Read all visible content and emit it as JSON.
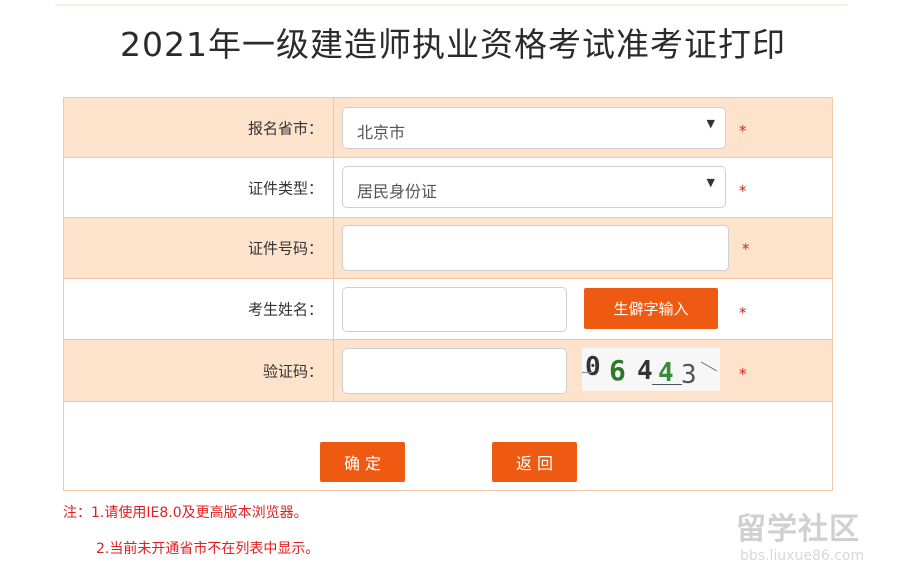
{
  "page": {
    "title": "2021年一级建造师执业资格考试准考证打印"
  },
  "form": {
    "province": {
      "label": "报名省市：",
      "value": "北京市",
      "required": "*"
    },
    "id_type": {
      "label": "证件类型：",
      "value": "居民身份证",
      "required": "*"
    },
    "id_number": {
      "label": "证件号码：",
      "value": "",
      "required": "*"
    },
    "name": {
      "label": "考生姓名：",
      "value": "",
      "rare_char_button": "生僻字输入",
      "required": "*"
    },
    "captcha": {
      "label": "验证码：",
      "value": "",
      "image_text": "06443",
      "required": "*"
    }
  },
  "buttons": {
    "confirm": "确 定",
    "back": "返 回"
  },
  "notes": {
    "line1": "注：1.请使用IE8.0及更高版本浏览器。",
    "line2": "2.当前未开通省市不在列表中显示。"
  },
  "watermark": {
    "brand": "留学社区",
    "url": "bbs.liuxue86.com"
  },
  "colors": {
    "accent": "#ef5a13",
    "row_shade": "#fde3cc",
    "border": "#f0c8a8",
    "required": "#e02020"
  }
}
